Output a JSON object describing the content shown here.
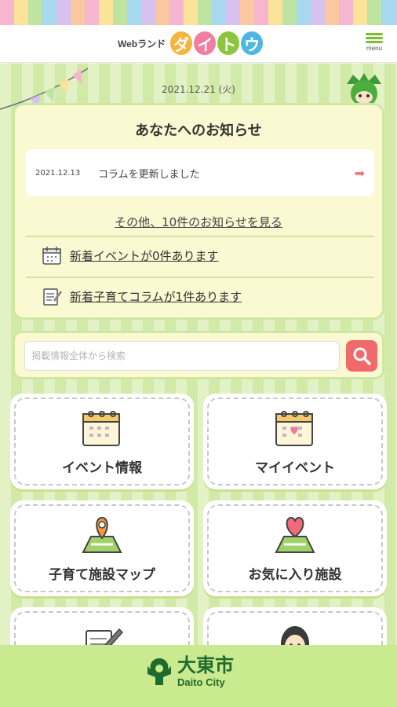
{
  "header": {
    "logo_small": "Webランド",
    "logo_letters": [
      {
        "char": "ダ",
        "color": "#f3b53c"
      },
      {
        "char": "イ",
        "color": "#f07ea3"
      },
      {
        "char": "ト",
        "color": "#8cc63f"
      },
      {
        "char": "ウ",
        "color": "#4fb6e3"
      }
    ],
    "menu_label": "menu"
  },
  "date": "2021.12.21 (火)",
  "notices": {
    "title": "あなたへのお知らせ",
    "items": [
      {
        "date": "2021.12.13",
        "text": "コラムを更新しました",
        "icon": "arrow-right-icon"
      }
    ],
    "more_link": "その他、10件のお知らせを見る",
    "rows": [
      {
        "icon": "calendar-icon",
        "text": "新着イベントが0件あります"
      },
      {
        "icon": "memo-icon",
        "text": "新着子育てコラムが1件あります"
      }
    ]
  },
  "search": {
    "placeholder": "掲載情報全体から検索",
    "icon": "search-icon"
  },
  "tiles": [
    {
      "label": "イベント情報",
      "icon": "calendar-icon"
    },
    {
      "label": "マイイベント",
      "icon": "calendar-heart-icon"
    },
    {
      "label": "子育て施設マップ",
      "icon": "map-pin-icon"
    },
    {
      "label": "お気に入り施設",
      "icon": "map-heart-icon"
    },
    {
      "label": "",
      "icon": "pen-paper-icon"
    },
    {
      "label": "",
      "icon": "person-icon"
    }
  ],
  "footer": {
    "name_jp": "大東市",
    "name_en": "Daito City"
  },
  "colors": {
    "accent_green": "#7bbf2d",
    "accent_red": "#f06a6a",
    "panel_bg": "#fbf9d2"
  }
}
